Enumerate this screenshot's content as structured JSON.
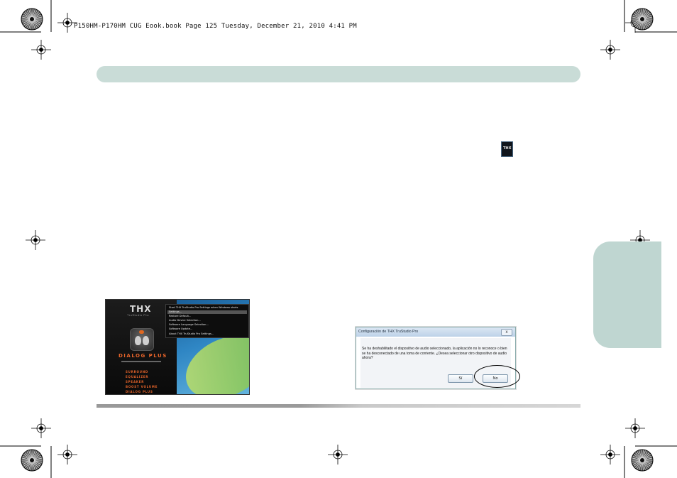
{
  "print_header": "P150HM-P170HM CUG Eook.book  Page 125  Tuesday, December 21, 2010  4:41 PM",
  "tray_icon_label": "THX",
  "thx_panel": {
    "logo": "THX",
    "logo_sub": "TruStudio Pro",
    "product_title": "DIALOG PLUS",
    "feature_items": [
      "SURROUND",
      "EQUALIZER",
      "SPEAKER",
      "BOOST VOLUME",
      "DIALOG PLUS"
    ],
    "context_menu": [
      "Start THX TruStudio Pro Settings when Windows starts",
      "Settings...",
      "Restore Default...",
      "Audio Device Selection...",
      "Software Language Selection...",
      "Software Update...",
      "About THX TruStudio Pro Settings..."
    ]
  },
  "dialog": {
    "title": "Configuración de THX TruStudio Pro",
    "close_label": "x",
    "message": "Se ha deshabilitado el dispositivo de audio seleccionado, la aplicación no lo reconoce o bien se ha desconectado de una toma de corriente. ¿Desea seleccionar otro dispositivo de audio ahora?",
    "yes_label": "Sí",
    "no_label": "No"
  },
  "colors": {
    "header_bar": "#c9dcd7",
    "side_tab": "#bfd6d1",
    "thx_accent": "#e7642a"
  }
}
